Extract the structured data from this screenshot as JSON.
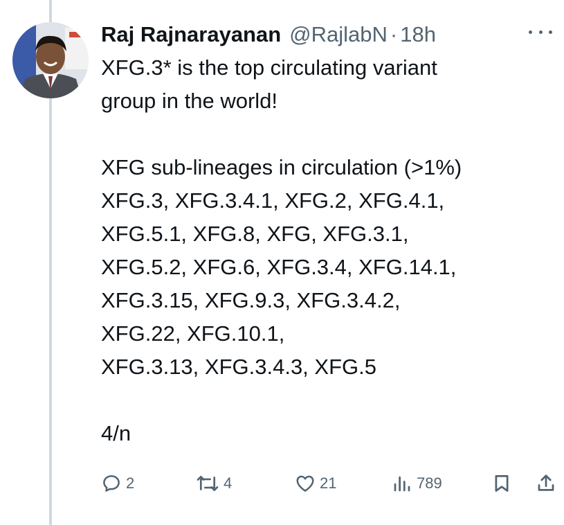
{
  "tweet": {
    "author_name": "Raj Rajnarayanan",
    "author_handle": "@RajlabN",
    "separator": "·",
    "timestamp": "18h",
    "text": "XFG.3* is the top circulating variant\ngroup in the world!\n\nXFG sub-lineages in circulation (>1%)\nXFG.3, XFG.3.4.1, XFG.2, XFG.4.1,\nXFG.5.1, XFG.8, XFG, XFG.3.1,\nXFG.5.2, XFG.6, XFG.3.4, XFG.14.1,\nXFG.3.15, XFG.9.3, XFG.3.4.2,\nXFG.22, XFG.10.1,\nXFG.3.13, XFG.3.4.3, XFG.5\n\n4/n"
  },
  "actions": {
    "replies": "2",
    "reposts": "4",
    "likes": "21",
    "views": "789"
  },
  "icons": {
    "more": "more-horizontal-icon",
    "reply": "reply-icon",
    "repost": "repost-icon",
    "like": "heart-icon",
    "views": "views-icon",
    "bookmark": "bookmark-icon",
    "share": "share-icon"
  },
  "colors": {
    "text": "#0f1419",
    "secondary": "#536471",
    "thread_line": "#cfd9de",
    "background": "#ffffff"
  }
}
